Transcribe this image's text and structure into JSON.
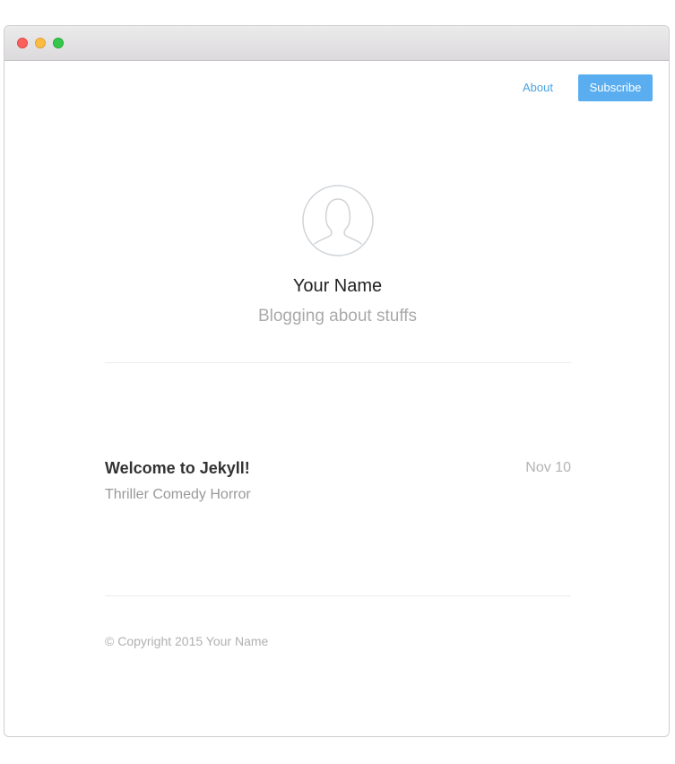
{
  "window": {
    "controls": [
      "close",
      "minimize",
      "maximize"
    ]
  },
  "nav": {
    "about_label": "About",
    "subscribe_label": "Subscribe"
  },
  "profile": {
    "avatar_icon": "user-silhouette-icon",
    "name": "Your Name",
    "tagline": "Blogging about stuffs"
  },
  "posts": [
    {
      "title": "Welcome to Jekyll!",
      "date": "Nov 10",
      "tags": "Thriller Comedy Horror"
    }
  ],
  "footer": {
    "copyright": "© Copyright 2015 Your Name"
  },
  "colors": {
    "accent": "#5aaef0",
    "link": "#4aa3df",
    "muted": "#aaaaaa",
    "title_text": "#333333"
  }
}
